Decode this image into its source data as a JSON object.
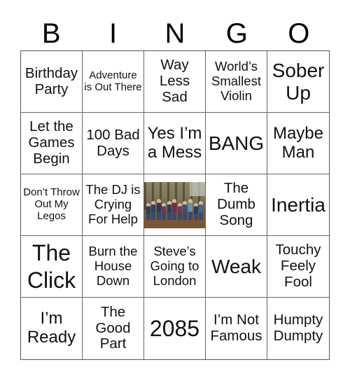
{
  "header": {
    "letters": [
      "B",
      "I",
      "N",
      "G",
      "O"
    ]
  },
  "card": {
    "cells": [
      "Birthday Party",
      "Adventure is Out There",
      "Way Less Sad",
      "World’s Smallest Violin",
      "Sober Up",
      "Let the Games Begin",
      "100 Bad Days",
      "Yes I’m a Mess",
      "BANG",
      "Maybe Man",
      "Don’t Throw Out My Legos",
      "The DJ is Crying For Help",
      "",
      "The Dumb Song",
      "Inertia",
      "The Click",
      "Burn the House Down",
      "Steve’s Going to London",
      "Weak",
      "Touchy Feely Fool",
      "I’m Ready",
      "The Good Part",
      "2085",
      "I’m Not Famous",
      "Humpty Dumpty"
    ],
    "free_space": {
      "type": "photo",
      "description": "group photo of kids in a forest",
      "alt": "Group photo"
    },
    "kid_shirt_colors": [
      "#2c3e5c",
      "#37415a",
      "#2b3a5a",
      "#7a3550",
      "#2f3b5c",
      "#6e2f45",
      "#7a3550",
      "#3d4f78",
      "#6d8fb8",
      "#2f3b5c",
      "#3f6a9a"
    ]
  }
}
